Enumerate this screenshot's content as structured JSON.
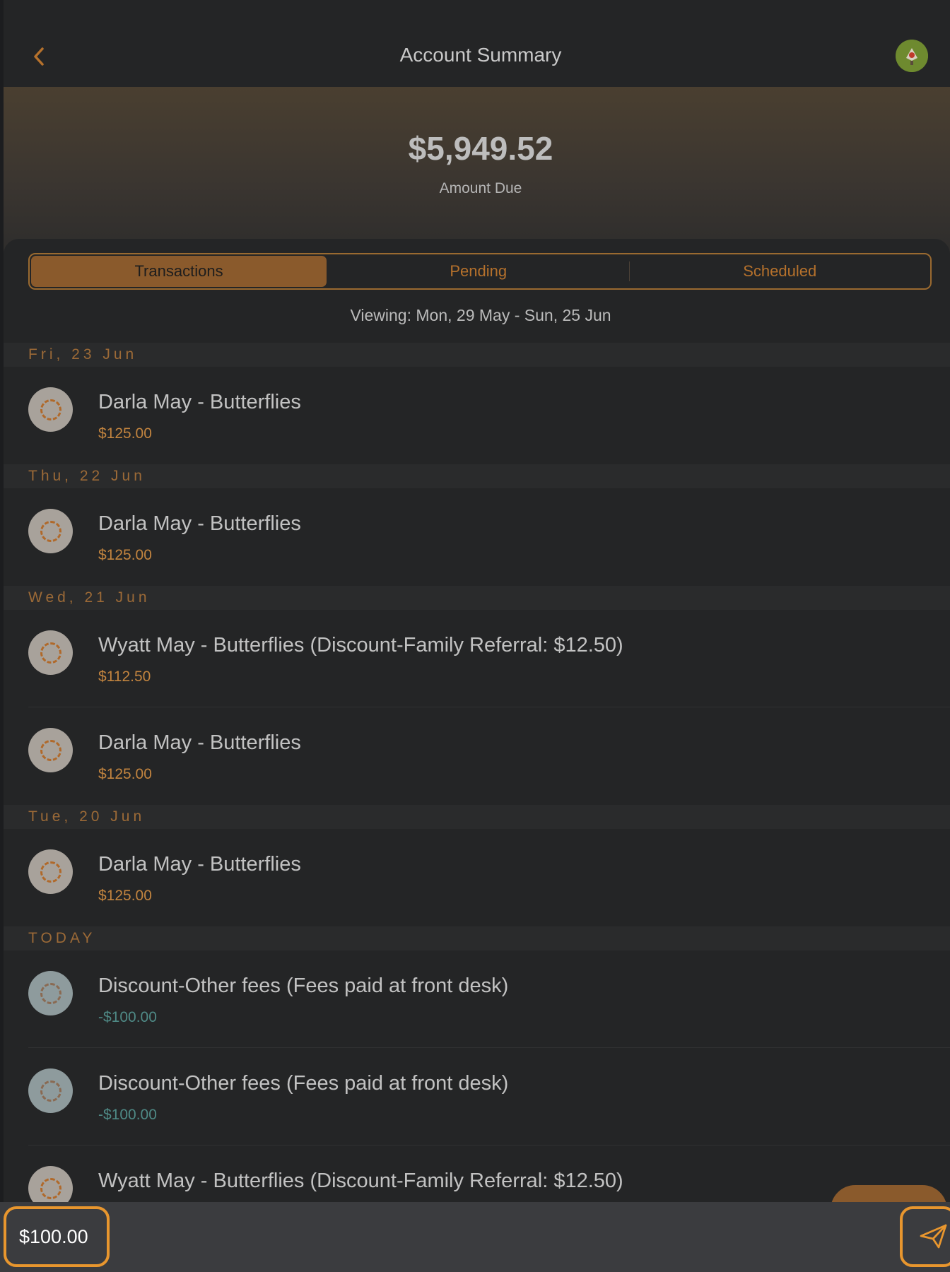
{
  "header": {
    "title": "Account Summary",
    "back_icon": "chevron-left-icon",
    "accent_color": "#b5712c"
  },
  "summary": {
    "amount": "$5,949.52",
    "label": "Amount Due"
  },
  "tabs": [
    {
      "label": "Transactions",
      "active": true
    },
    {
      "label": "Pending",
      "active": false
    },
    {
      "label": "Scheduled",
      "active": false
    }
  ],
  "viewing": "Viewing: Mon, 29 May - Sun, 25 Jun",
  "sections": [
    {
      "header": "Fri, 23 Jun",
      "items": [
        {
          "title": "Darla May - Butterflies",
          "amount": "$125.00",
          "type": "charge"
        }
      ]
    },
    {
      "header": "Thu, 22 Jun",
      "items": [
        {
          "title": "Darla May - Butterflies",
          "amount": "$125.00",
          "type": "charge"
        }
      ]
    },
    {
      "header": "Wed, 21 Jun",
      "items": [
        {
          "title": "Wyatt May - Butterflies  (Discount-Family Referral: $12.50)",
          "amount": "$112.50",
          "type": "charge"
        },
        {
          "title": "Darla May - Butterflies",
          "amount": "$125.00",
          "type": "charge"
        }
      ]
    },
    {
      "header": "Tue, 20 Jun",
      "items": [
        {
          "title": "Darla May - Butterflies",
          "amount": "$125.00",
          "type": "charge"
        }
      ]
    },
    {
      "header": "TODAY",
      "items": [
        {
          "title": "Discount-Other fees (Fees paid at front desk)",
          "amount": "-$100.00",
          "type": "credit"
        },
        {
          "title": "Discount-Other fees (Fees paid at front desk)",
          "amount": "-$100.00",
          "type": "credit"
        },
        {
          "title": "Wyatt May - Butterflies  (Discount-Family Referral: $12.50)",
          "amount": "",
          "type": "charge"
        }
      ]
    }
  ],
  "input_bar": {
    "amount_value": "$100.00",
    "send_icon": "paper-plane-icon"
  }
}
